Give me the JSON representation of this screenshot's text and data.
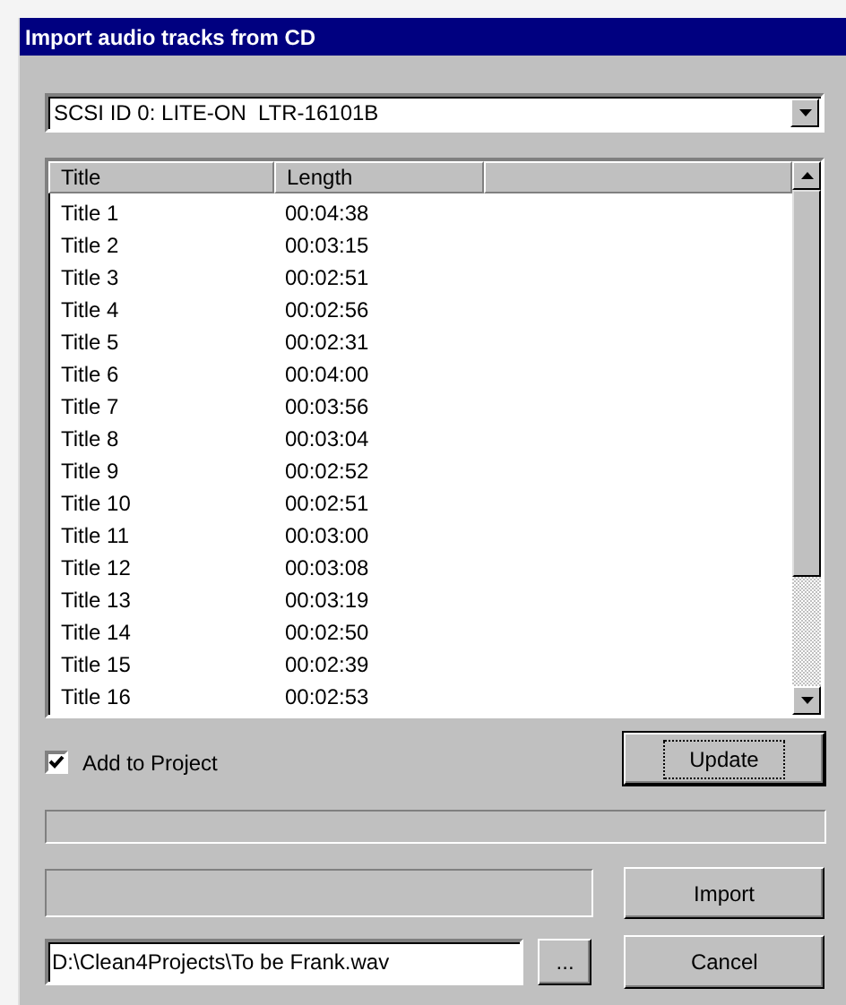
{
  "window": {
    "title": "Import audio tracks from CD"
  },
  "drive_select": {
    "value": "SCSI ID 0: LITE-ON  LTR-16101B"
  },
  "track_list": {
    "columns": [
      "Title",
      "Length"
    ],
    "rows": [
      {
        "title": "Title 1",
        "length": "00:04:38"
      },
      {
        "title": "Title 2",
        "length": "00:03:15"
      },
      {
        "title": "Title 3",
        "length": "00:02:51"
      },
      {
        "title": "Title 4",
        "length": "00:02:56"
      },
      {
        "title": "Title 5",
        "length": "00:02:31"
      },
      {
        "title": "Title 6",
        "length": "00:04:00"
      },
      {
        "title": "Title 7",
        "length": "00:03:56"
      },
      {
        "title": "Title 8",
        "length": "00:03:04"
      },
      {
        "title": "Title 9",
        "length": "00:02:52"
      },
      {
        "title": "Title 10",
        "length": "00:02:51"
      },
      {
        "title": "Title 11",
        "length": "00:03:00"
      },
      {
        "title": "Title 12",
        "length": "00:03:08"
      },
      {
        "title": "Title 13",
        "length": "00:03:19"
      },
      {
        "title": "Title 14",
        "length": "00:02:50"
      },
      {
        "title": "Title 15",
        "length": "00:02:39"
      },
      {
        "title": "Title 16",
        "length": "00:02:53"
      }
    ]
  },
  "add_to_project": {
    "label": "Add to Project",
    "checked": true
  },
  "update_button": {
    "label": "Update"
  },
  "progress_bars": [
    {
      "level": 0
    },
    {
      "level": 0
    }
  ],
  "import_button": {
    "label": "Import"
  },
  "output_file": {
    "value": "D:\\Clean4Projects\\To be Frank.wav"
  },
  "browse_button": {
    "label": "..."
  },
  "cancel_button": {
    "label": "Cancel"
  }
}
